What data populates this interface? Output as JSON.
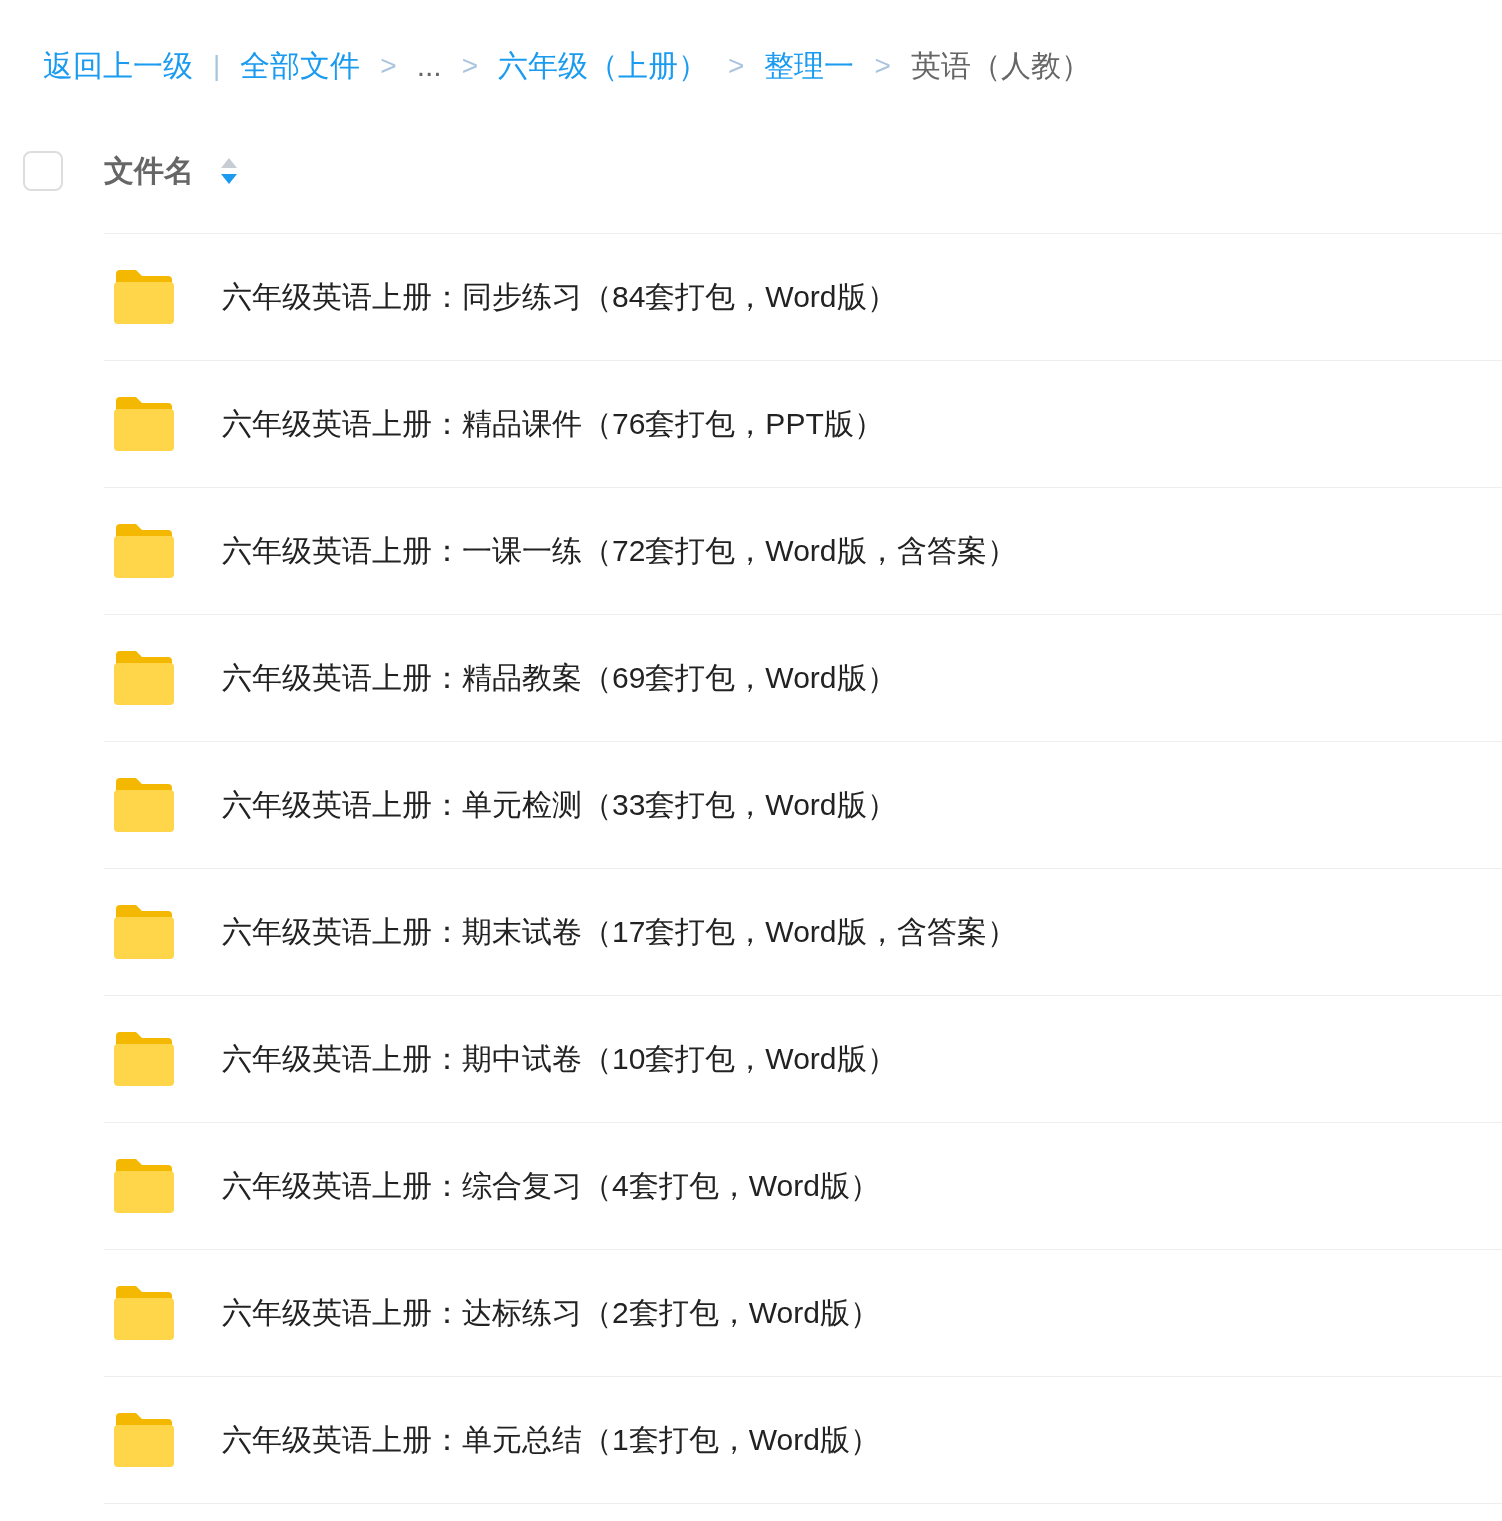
{
  "breadcrumb": {
    "back": "返回上一级",
    "divider": "|",
    "items": [
      {
        "separator": ">",
        "label": "全部文件",
        "kind": "link"
      },
      {
        "separator": ">",
        "label": "...",
        "kind": "plain"
      },
      {
        "separator": ">",
        "label": "六年级（上册）",
        "kind": "link"
      },
      {
        "separator": ">",
        "label": "整理一",
        "kind": "link"
      },
      {
        "label": "英语（人教）",
        "kind": "current"
      }
    ]
  },
  "header": {
    "select_all": {
      "checked": false
    },
    "column": "文件名",
    "sort_descending": true
  },
  "files": [
    {
      "name": "六年级英语上册：同步练习（84套打包，Word版）"
    },
    {
      "name": "六年级英语上册：精品课件（76套打包，PPT版）"
    },
    {
      "name": "六年级英语上册：一课一练（72套打包，Word版，含答案）"
    },
    {
      "name": "六年级英语上册：精品教案（69套打包，Word版）"
    },
    {
      "name": "六年级英语上册：单元检测（33套打包，Word版）"
    },
    {
      "name": "六年级英语上册：期末试卷（17套打包，Word版，含答案）"
    },
    {
      "name": "六年级英语上册：期中试卷（10套打包，Word版）"
    },
    {
      "name": "六年级英语上册：综合复习（4套打包，Word版）"
    },
    {
      "name": "六年级英语上册：达标练习（2套打包，Word版）"
    },
    {
      "name": "六年级英语上册：单元总结（1套打包，Word版）"
    }
  ]
}
